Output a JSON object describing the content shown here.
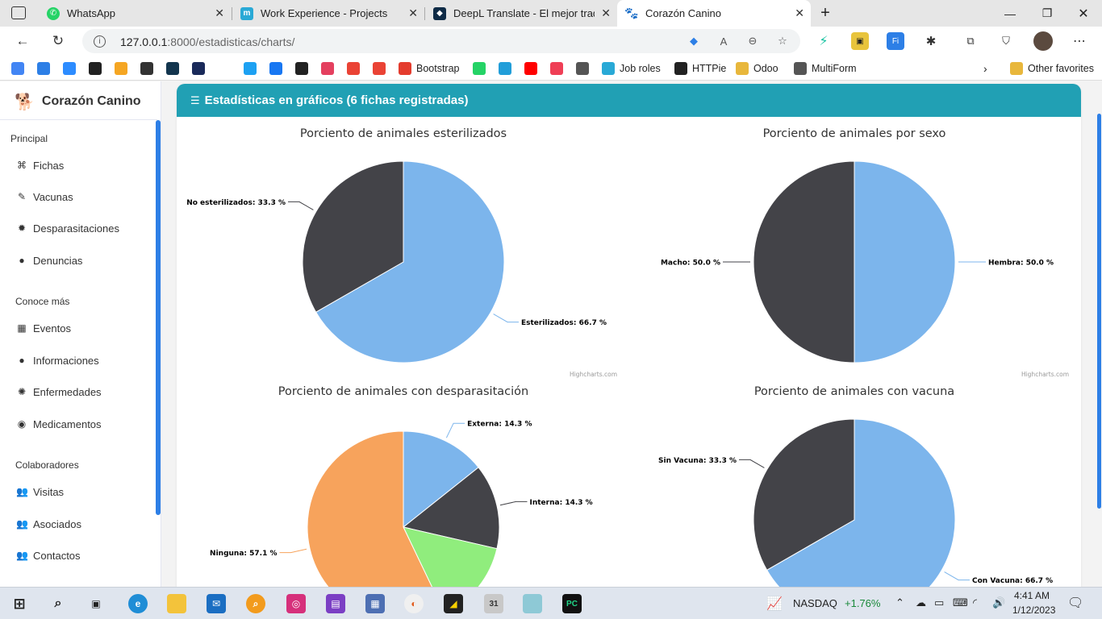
{
  "browser": {
    "tabs": [
      {
        "title": "WhatsApp",
        "icon": "whatsapp-icon",
        "color": "#25d366",
        "active": false
      },
      {
        "title": "Work Experience - Projects",
        "icon": "m-icon",
        "color": "#29a9d6",
        "active": false
      },
      {
        "title": "DeepL Translate - El mejor traduc",
        "icon": "deepl-icon",
        "color": "#0f2b46",
        "active": false
      },
      {
        "title": "Corazón Canino",
        "icon": "paw-icon",
        "color": "#222222",
        "active": true
      }
    ],
    "url_host": "127.0.0.1",
    "url_rest": ":8000/estadisticas/charts/",
    "bookmarks": [
      {
        "label": "",
        "icon": "google-icon",
        "color": "#4285f4"
      },
      {
        "label": "",
        "icon": "search-icon",
        "color": "#2d7fe6"
      },
      {
        "label": "",
        "icon": "zoom-icon",
        "color": "#2d8cff"
      },
      {
        "label": "",
        "icon": "uci-icon",
        "color": "#222222"
      },
      {
        "label": "",
        "icon": "orange-circle-icon",
        "color": "#f5a623"
      },
      {
        "label": "",
        "icon": "fire-icon",
        "color": "#333333"
      },
      {
        "label": "",
        "icon": "circle-logo-icon",
        "color": "#13354e"
      },
      {
        "label": "",
        "icon": "uci-square-icon",
        "color": "#1a2a5a"
      },
      {
        "label": "",
        "icon": "twitter-icon",
        "color": "#1da1f2"
      },
      {
        "label": "",
        "icon": "facebook-icon",
        "color": "#1877f2"
      },
      {
        "label": "",
        "icon": "github-icon",
        "color": "#222222"
      },
      {
        "label": "",
        "icon": "instagram-icon",
        "color": "#e4405f"
      },
      {
        "label": "",
        "icon": "gmail-icon",
        "color": "#ea4335"
      },
      {
        "label": "",
        "icon": "gmail-icon",
        "color": "#ea4335"
      },
      {
        "label": "Bootstrap",
        "icon": "bootstrap-icon",
        "color": "#e43c2e"
      },
      {
        "label": "",
        "icon": "whatsapp-icon",
        "color": "#25d366"
      },
      {
        "label": "",
        "icon": "telegram-icon",
        "color": "#229ed9"
      },
      {
        "label": "",
        "icon": "youtube-icon",
        "color": "#ff0000"
      },
      {
        "label": "",
        "icon": "pocket-icon",
        "color": "#ef3f56"
      },
      {
        "label": "",
        "icon": "document-icon",
        "color": "#555555"
      },
      {
        "label": "Job roles",
        "icon": "m-icon",
        "color": "#29a9d6"
      },
      {
        "label": "HTTPie",
        "icon": "httpie-icon",
        "color": "#222222"
      },
      {
        "label": "Odoo",
        "icon": "folder-icon",
        "color": "#e8b73c"
      },
      {
        "label": "MultiForm",
        "icon": "form-icon",
        "color": "#555555"
      }
    ],
    "other_favorites": "Other favorites"
  },
  "sidebar": {
    "brand": "Corazón Canino",
    "sections": [
      {
        "title": "Principal",
        "items": [
          {
            "label": "Fichas",
            "icon": "fichas-icon"
          },
          {
            "label": "Vacunas",
            "icon": "syringe-icon"
          },
          {
            "label": "Desparasitaciones",
            "icon": "bug-icon"
          },
          {
            "label": "Denuncias",
            "icon": "chat-icon"
          }
        ]
      },
      {
        "title": "Conoce más",
        "items": [
          {
            "label": "Eventos",
            "icon": "calendar-icon"
          },
          {
            "label": "Informaciones",
            "icon": "info-icon"
          },
          {
            "label": "Enfermedades",
            "icon": "virus-icon"
          },
          {
            "label": "Medicamentos",
            "icon": "pill-icon"
          }
        ]
      },
      {
        "title": "Colaboradores",
        "items": [
          {
            "label": "Visitas",
            "icon": "users-icon"
          },
          {
            "label": "Asociados",
            "icon": "users-icon"
          },
          {
            "label": "Contactos",
            "icon": "users-icon"
          }
        ]
      }
    ]
  },
  "main": {
    "header_title": "Estadísticas en gráficos (6 fichas registradas)"
  },
  "chart_data": [
    {
      "type": "pie",
      "title": "Porciento de animales esterilizados",
      "slices": [
        {
          "label": "Esterilizados",
          "value": 66.7,
          "color": "#7cb5ec"
        },
        {
          "label": "No esterilizados",
          "value": 33.3,
          "color": "#434348"
        }
      ],
      "credit": "Highcharts.com"
    },
    {
      "type": "pie",
      "title": "Porciento de animales por sexo",
      "slices": [
        {
          "label": "Hembra",
          "value": 50.0,
          "color": "#7cb5ec"
        },
        {
          "label": "Macho",
          "value": 50.0,
          "color": "#434348"
        }
      ],
      "credit": "Highcharts.com"
    },
    {
      "type": "pie",
      "title": "Porciento de animales con desparasitación",
      "slices": [
        {
          "label": "Externa",
          "value": 14.3,
          "color": "#7cb5ec"
        },
        {
          "label": "Interna",
          "value": 14.3,
          "color": "#434348"
        },
        {
          "label": "",
          "value": 14.3,
          "color": "#90ed7d"
        },
        {
          "label": "Ninguna",
          "value": 57.1,
          "color": "#f7a35c"
        }
      ],
      "credit": ""
    },
    {
      "type": "pie",
      "title": "Porciento de animales con vacuna",
      "slices": [
        {
          "label": "Con Vacuna",
          "value": 66.7,
          "color": "#7cb5ec"
        },
        {
          "label": "Sin Vacuna",
          "value": 33.3,
          "color": "#434348"
        }
      ],
      "credit": ""
    }
  ],
  "taskbar": {
    "stock_name": "NASDAQ",
    "stock_change": "+1.76%",
    "time": "4:41 AM",
    "date": "1/12/2023"
  }
}
